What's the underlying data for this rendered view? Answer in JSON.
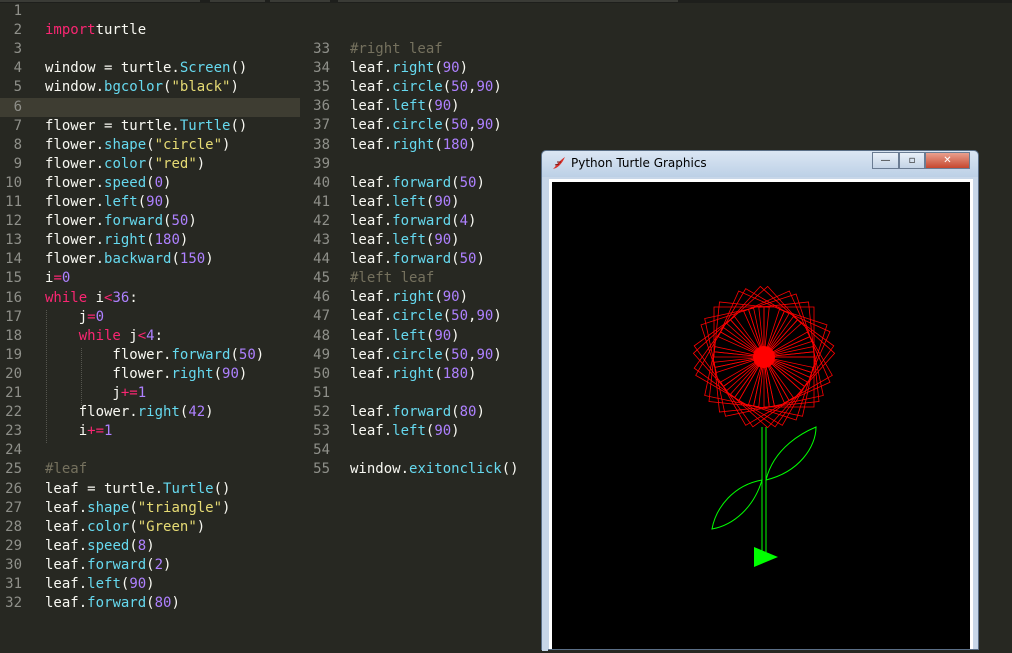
{
  "editor": {
    "left_lines": [
      {
        "n": "1",
        "t": []
      },
      {
        "n": "2",
        "t": [
          [
            "kw",
            "import"
          ],
          [
            "",
            "turtle"
          ]
        ]
      },
      {
        "n": "3",
        "t": []
      },
      {
        "n": "4",
        "t": [
          [
            "",
            "window = turtle."
          ],
          [
            "fn",
            "Screen"
          ],
          [
            "",
            "()"
          ]
        ]
      },
      {
        "n": "5",
        "t": [
          [
            "",
            "window."
          ],
          [
            "fn",
            "bgcolor"
          ],
          [
            "",
            "("
          ],
          [
            "str",
            "\"black\""
          ],
          [
            "",
            ")"
          ]
        ]
      },
      {
        "n": "6",
        "t": [],
        "current": true
      },
      {
        "n": "7",
        "t": [
          [
            "",
            "flower = turtle."
          ],
          [
            "fn",
            "Turtle"
          ],
          [
            "",
            "()"
          ]
        ]
      },
      {
        "n": "8",
        "t": [
          [
            "",
            "flower."
          ],
          [
            "fn",
            "shape"
          ],
          [
            "",
            "("
          ],
          [
            "str",
            "\"circle\""
          ],
          [
            "",
            ")"
          ]
        ]
      },
      {
        "n": "9",
        "t": [
          [
            "",
            "flower."
          ],
          [
            "fn",
            "color"
          ],
          [
            "",
            "("
          ],
          [
            "str",
            "\"red\""
          ],
          [
            "",
            ")"
          ]
        ]
      },
      {
        "n": "10",
        "t": [
          [
            "",
            "flower."
          ],
          [
            "fn",
            "speed"
          ],
          [
            "",
            "("
          ],
          [
            "num",
            "0"
          ],
          [
            "",
            ")"
          ]
        ]
      },
      {
        "n": "11",
        "t": [
          [
            "",
            "flower."
          ],
          [
            "fn",
            "left"
          ],
          [
            "",
            "("
          ],
          [
            "num",
            "90"
          ],
          [
            "",
            ")"
          ]
        ]
      },
      {
        "n": "12",
        "t": [
          [
            "",
            "flower."
          ],
          [
            "fn",
            "forward"
          ],
          [
            "",
            "("
          ],
          [
            "num",
            "50"
          ],
          [
            "",
            ")"
          ]
        ]
      },
      {
        "n": "13",
        "t": [
          [
            "",
            "flower."
          ],
          [
            "fn",
            "right"
          ],
          [
            "",
            "("
          ],
          [
            "num",
            "180"
          ],
          [
            "",
            ")"
          ]
        ]
      },
      {
        "n": "14",
        "t": [
          [
            "",
            "flower."
          ],
          [
            "fn",
            "backward"
          ],
          [
            "",
            "("
          ],
          [
            "num",
            "150"
          ],
          [
            "",
            ")"
          ]
        ]
      },
      {
        "n": "15",
        "t": [
          [
            "",
            "i"
          ],
          [
            "op",
            "="
          ],
          [
            "num",
            "0"
          ]
        ]
      },
      {
        "n": "16",
        "t": [
          [
            "kw",
            "while"
          ],
          [
            "",
            " i"
          ],
          [
            "op",
            "<"
          ],
          [
            "num",
            "36"
          ],
          [
            "",
            ":"
          ]
        ]
      },
      {
        "n": "17",
        "t": [
          [
            "",
            "    j"
          ],
          [
            "op",
            "="
          ],
          [
            "num",
            "0"
          ]
        ]
      },
      {
        "n": "18",
        "t": [
          [
            "",
            "    "
          ],
          [
            "kw",
            "while"
          ],
          [
            "",
            " j"
          ],
          [
            "op",
            "<"
          ],
          [
            "num",
            "4"
          ],
          [
            "",
            ":"
          ]
        ]
      },
      {
        "n": "19",
        "t": [
          [
            "",
            "        flower."
          ],
          [
            "fn",
            "forward"
          ],
          [
            "",
            "("
          ],
          [
            "num",
            "50"
          ],
          [
            "",
            ")"
          ]
        ]
      },
      {
        "n": "20",
        "t": [
          [
            "",
            "        flower."
          ],
          [
            "fn",
            "right"
          ],
          [
            "",
            "("
          ],
          [
            "num",
            "90"
          ],
          [
            "",
            ")"
          ]
        ]
      },
      {
        "n": "21",
        "t": [
          [
            "",
            "        j"
          ],
          [
            "op",
            "+="
          ],
          [
            "num",
            "1"
          ]
        ]
      },
      {
        "n": "22",
        "t": [
          [
            "",
            "    flower."
          ],
          [
            "fn",
            "right"
          ],
          [
            "",
            "("
          ],
          [
            "num",
            "42"
          ],
          [
            "",
            ")"
          ]
        ]
      },
      {
        "n": "23",
        "t": [
          [
            "",
            "    i"
          ],
          [
            "op",
            "+="
          ],
          [
            "num",
            "1"
          ]
        ]
      },
      {
        "n": "24",
        "t": []
      },
      {
        "n": "25",
        "t": [
          [
            "cm",
            "#leaf"
          ]
        ]
      },
      {
        "n": "26",
        "t": [
          [
            "",
            "leaf = turtle."
          ],
          [
            "fn",
            "Turtle"
          ],
          [
            "",
            "()"
          ]
        ]
      },
      {
        "n": "27",
        "t": [
          [
            "",
            "leaf."
          ],
          [
            "fn",
            "shape"
          ],
          [
            "",
            "("
          ],
          [
            "str",
            "\"triangle\""
          ],
          [
            "",
            ")"
          ]
        ]
      },
      {
        "n": "28",
        "t": [
          [
            "",
            "leaf."
          ],
          [
            "fn",
            "color"
          ],
          [
            "",
            "("
          ],
          [
            "str",
            "\"Green\""
          ],
          [
            "",
            ")"
          ]
        ]
      },
      {
        "n": "29",
        "t": [
          [
            "",
            "leaf."
          ],
          [
            "fn",
            "speed"
          ],
          [
            "",
            "("
          ],
          [
            "num",
            "8"
          ],
          [
            "",
            ")"
          ]
        ]
      },
      {
        "n": "30",
        "t": [
          [
            "",
            "leaf."
          ],
          [
            "fn",
            "forward"
          ],
          [
            "",
            "("
          ],
          [
            "num",
            "2"
          ],
          [
            "",
            ")"
          ]
        ]
      },
      {
        "n": "31",
        "t": [
          [
            "",
            "leaf."
          ],
          [
            "fn",
            "left"
          ],
          [
            "",
            "("
          ],
          [
            "num",
            "90"
          ],
          [
            "",
            ")"
          ]
        ]
      },
      {
        "n": "32",
        "t": [
          [
            "",
            "leaf."
          ],
          [
            "fn",
            "forward"
          ],
          [
            "",
            "("
          ],
          [
            "num",
            "80"
          ],
          [
            "",
            ")"
          ]
        ]
      }
    ],
    "right_lines": [
      {
        "n": "33",
        "t": [
          [
            "cm",
            "#right leaf"
          ]
        ]
      },
      {
        "n": "34",
        "t": [
          [
            "",
            "leaf."
          ],
          [
            "fn",
            "right"
          ],
          [
            "",
            "("
          ],
          [
            "num",
            "90"
          ],
          [
            "",
            ")"
          ]
        ]
      },
      {
        "n": "35",
        "t": [
          [
            "",
            "leaf."
          ],
          [
            "fn",
            "circle"
          ],
          [
            "",
            "("
          ],
          [
            "num",
            "50"
          ],
          [
            "",
            ","
          ],
          [
            "num",
            "90"
          ],
          [
            "",
            ")"
          ]
        ]
      },
      {
        "n": "36",
        "t": [
          [
            "",
            "leaf."
          ],
          [
            "fn",
            "left"
          ],
          [
            "",
            "("
          ],
          [
            "num",
            "90"
          ],
          [
            "",
            ")"
          ]
        ]
      },
      {
        "n": "37",
        "t": [
          [
            "",
            "leaf."
          ],
          [
            "fn",
            "circle"
          ],
          [
            "",
            "("
          ],
          [
            "num",
            "50"
          ],
          [
            "",
            ","
          ],
          [
            "num",
            "90"
          ],
          [
            "",
            ")"
          ]
        ]
      },
      {
        "n": "38",
        "t": [
          [
            "",
            "leaf."
          ],
          [
            "fn",
            "right"
          ],
          [
            "",
            "("
          ],
          [
            "num",
            "180"
          ],
          [
            "",
            ")"
          ]
        ]
      },
      {
        "n": "39",
        "t": []
      },
      {
        "n": "40",
        "t": [
          [
            "",
            "leaf."
          ],
          [
            "fn",
            "forward"
          ],
          [
            "",
            "("
          ],
          [
            "num",
            "50"
          ],
          [
            "",
            ")"
          ]
        ]
      },
      {
        "n": "41",
        "t": [
          [
            "",
            "leaf."
          ],
          [
            "fn",
            "left"
          ],
          [
            "",
            "("
          ],
          [
            "num",
            "90"
          ],
          [
            "",
            ")"
          ]
        ]
      },
      {
        "n": "42",
        "t": [
          [
            "",
            "leaf."
          ],
          [
            "fn",
            "forward"
          ],
          [
            "",
            "("
          ],
          [
            "num",
            "4"
          ],
          [
            "",
            ")"
          ]
        ]
      },
      {
        "n": "43",
        "t": [
          [
            "",
            "leaf."
          ],
          [
            "fn",
            "left"
          ],
          [
            "",
            "("
          ],
          [
            "num",
            "90"
          ],
          [
            "",
            ")"
          ]
        ]
      },
      {
        "n": "44",
        "t": [
          [
            "",
            "leaf."
          ],
          [
            "fn",
            "forward"
          ],
          [
            "",
            "("
          ],
          [
            "num",
            "50"
          ],
          [
            "",
            ")"
          ]
        ]
      },
      {
        "n": "45",
        "t": [
          [
            "cm",
            "#left leaf"
          ]
        ]
      },
      {
        "n": "46",
        "t": [
          [
            "",
            "leaf."
          ],
          [
            "fn",
            "right"
          ],
          [
            "",
            "("
          ],
          [
            "num",
            "90"
          ],
          [
            "",
            ")"
          ]
        ]
      },
      {
        "n": "47",
        "t": [
          [
            "",
            "leaf."
          ],
          [
            "fn",
            "circle"
          ],
          [
            "",
            "("
          ],
          [
            "num",
            "50"
          ],
          [
            "",
            ","
          ],
          [
            "num",
            "90"
          ],
          [
            "",
            ")"
          ]
        ]
      },
      {
        "n": "48",
        "t": [
          [
            "",
            "leaf."
          ],
          [
            "fn",
            "left"
          ],
          [
            "",
            "("
          ],
          [
            "num",
            "90"
          ],
          [
            "",
            ")"
          ]
        ]
      },
      {
        "n": "49",
        "t": [
          [
            "",
            "leaf."
          ],
          [
            "fn",
            "circle"
          ],
          [
            "",
            "("
          ],
          [
            "num",
            "50"
          ],
          [
            "",
            ","
          ],
          [
            "num",
            "90"
          ],
          [
            "",
            ")"
          ]
        ]
      },
      {
        "n": "50",
        "t": [
          [
            "",
            "leaf."
          ],
          [
            "fn",
            "right"
          ],
          [
            "",
            "("
          ],
          [
            "num",
            "180"
          ],
          [
            "",
            ")"
          ]
        ]
      },
      {
        "n": "51",
        "t": []
      },
      {
        "n": "52",
        "t": [
          [
            "",
            "leaf."
          ],
          [
            "fn",
            "forward"
          ],
          [
            "",
            "("
          ],
          [
            "num",
            "80"
          ],
          [
            "",
            ")"
          ]
        ]
      },
      {
        "n": "53",
        "t": [
          [
            "",
            "leaf."
          ],
          [
            "fn",
            "left"
          ],
          [
            "",
            "("
          ],
          [
            "num",
            "90"
          ],
          [
            "",
            ")"
          ]
        ]
      },
      {
        "n": "54",
        "t": []
      },
      {
        "n": "55",
        "t": [
          [
            "",
            "window."
          ],
          [
            "fn",
            "exitonclick"
          ],
          [
            "",
            "()"
          ]
        ]
      }
    ]
  },
  "turtle_window": {
    "title": "Python Turtle Graphics",
    "minimize_label": "—",
    "maximize_label": "▫",
    "close_label": "✕",
    "icon": "tk-feather-icon"
  },
  "colors": {
    "editor_bg": "#272822",
    "flower": "#ff0000",
    "leaf": "#00ff00"
  }
}
